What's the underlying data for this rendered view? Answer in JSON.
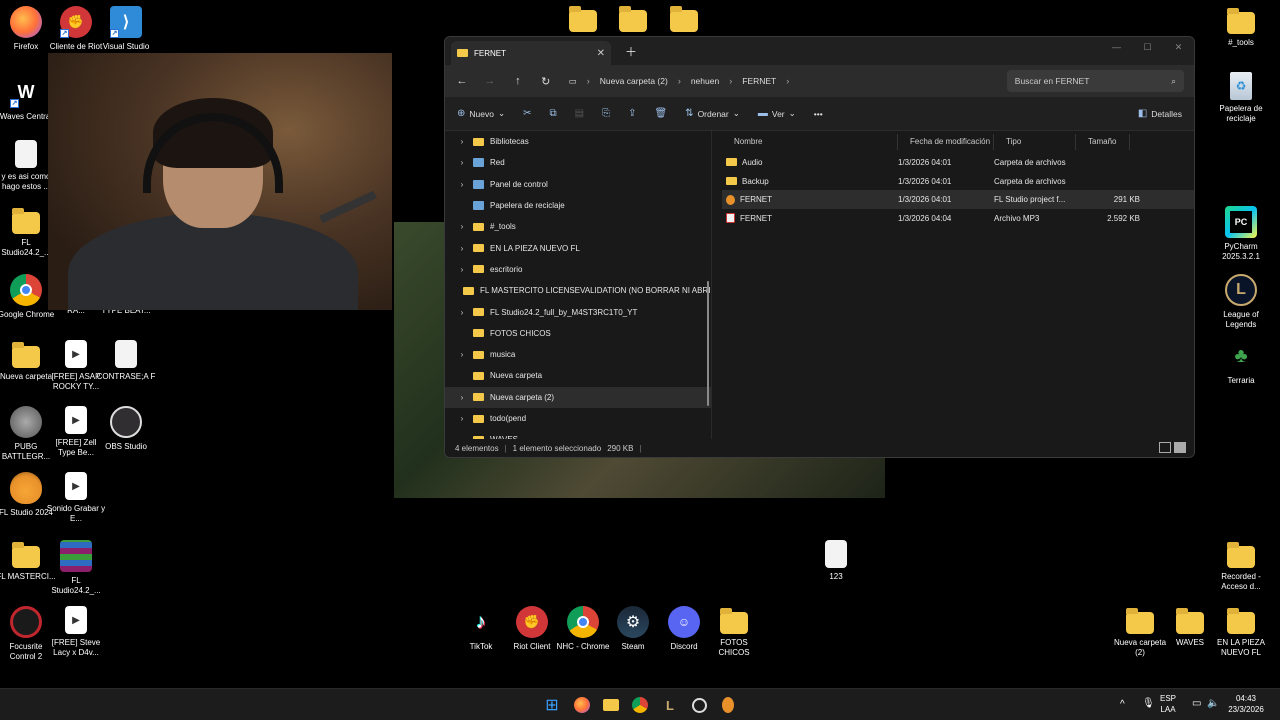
{
  "desktop": {
    "left_icons": [
      {
        "label": "Firefox",
        "icon": "firefox-icon",
        "color": "#ff7139"
      },
      {
        "label": "Cliente de Riot",
        "icon": "riot-icon",
        "color": "#d13639"
      },
      {
        "label": "Visual Studio Code",
        "icon": "vscode-icon",
        "color": "#2f8bd8"
      },
      {
        "label": "Waves Central",
        "icon": "waves-icon",
        "color": "#111111"
      },
      {
        "label": "y es asi como hago estos ...",
        "icon": "document-icon",
        "color": "#f3f3f3"
      },
      {
        "label": "FL Studio24.2_...",
        "icon": "folder-icon",
        "color": "#f4c949"
      },
      {
        "label": "Google Chrome",
        "icon": "chrome-icon",
        "color": "#4285f4"
      },
      {
        "label": "[FREE] ISAIAH RA...",
        "icon": "audio-file-icon",
        "color": "#ffffff"
      },
      {
        "label": "[FREE] CISCO TYPE BEAT...",
        "icon": "audio-file-icon",
        "color": "#ffffff"
      },
      {
        "label": "Nueva carpeta",
        "icon": "folder-icon",
        "color": "#f4c949"
      },
      {
        "label": "[FREE] ASAP ROCKY TY...",
        "icon": "audio-file-icon",
        "color": "#ffffff"
      },
      {
        "label": "CONTRASE;A F",
        "icon": "document-icon",
        "color": "#f3f3f3"
      },
      {
        "label": "PUBG BATTLEGR...",
        "icon": "pubg-icon",
        "color": "#888888"
      },
      {
        "label": "[FREE] Zell Type Be...",
        "icon": "audio-file-icon",
        "color": "#ffffff"
      },
      {
        "label": "OBS Studio",
        "icon": "obs-icon",
        "color": "#333333"
      },
      {
        "label": "FL Studio 2024",
        "icon": "fl-studio-icon",
        "color": "#e8912b"
      },
      {
        "label": "Sonido Grabar y E...",
        "icon": "audio-file-icon",
        "color": "#ffffff"
      },
      {
        "label": "FL MASTERCI...",
        "icon": "folder-icon",
        "color": "#f4c949"
      },
      {
        "label": "FL Studio24.2_...",
        "icon": "winrar-icon",
        "color": "#8b1f6b"
      },
      {
        "label": "Focusrite Control 2",
        "icon": "focusrite-icon",
        "color": "#c0262d"
      },
      {
        "label": "[FREE] Steve Lacy x D4v...",
        "icon": "audio-file-icon",
        "color": "#ffffff"
      }
    ],
    "right_icons": [
      {
        "label": "#_tools",
        "icon": "folder-icon"
      },
      {
        "label": "Papelera de reciclaje",
        "icon": "recycle-bin-icon"
      },
      {
        "label": "PyCharm 2025.3.2.1",
        "icon": "pycharm-icon"
      },
      {
        "label": "League of Legends",
        "icon": "league-icon"
      },
      {
        "label": "Terraria",
        "icon": "terraria-icon"
      },
      {
        "label": "Recorded - Acceso d...",
        "icon": "folder-icon"
      }
    ],
    "center_file": {
      "label": "123",
      "icon": "document-icon"
    },
    "dock_icons": [
      {
        "label": "TikTok",
        "icon": "tiktok-icon",
        "color": "#000000"
      },
      {
        "label": "Riot Client",
        "icon": "riot-icon",
        "color": "#d13639"
      },
      {
        "label": "NHC - Chrome",
        "icon": "chrome-icon",
        "color": "#4285f4"
      },
      {
        "label": "Steam",
        "icon": "steam-icon",
        "color": "#1b2838"
      },
      {
        "label": "Discord",
        "icon": "discord-icon",
        "color": "#5865f2"
      },
      {
        "label": "FOTOS CHICOS",
        "icon": "folder-icon",
        "color": "#f4c949"
      }
    ],
    "bottom_right_icons": [
      {
        "label": "Nueva carpeta (2)",
        "icon": "folder-icon"
      },
      {
        "label": "WAVES",
        "icon": "folder-icon"
      },
      {
        "label": "EN LA PIEZA NUEVO FL",
        "icon": "folder-icon"
      }
    ]
  },
  "explorer": {
    "tab_title": "FERNET",
    "breadcrumb": [
      "Nueva carpeta (2)",
      "nehuen",
      "FERNET"
    ],
    "search_placeholder": "Buscar en FERNET",
    "toolbar": {
      "new_label": "Nuevo",
      "sort_label": "Ordenar",
      "view_label": "Ver",
      "details_label": "Detalles"
    },
    "nav_items": [
      {
        "label": "Bibliotecas",
        "expandable": true,
        "type": "folder"
      },
      {
        "label": "Red",
        "expandable": true,
        "type": "system"
      },
      {
        "label": "Panel de control",
        "expandable": true,
        "type": "system"
      },
      {
        "label": "Papelera de reciclaje",
        "expandable": false,
        "type": "system"
      },
      {
        "label": "#_tools",
        "expandable": true,
        "type": "folder"
      },
      {
        "label": "EN LA PIEZA NUEVO FL",
        "expandable": true,
        "type": "folder"
      },
      {
        "label": "escritorio",
        "expandable": true,
        "type": "folder"
      },
      {
        "label": "FL MASTERCITO LICENSEVALIDATION (NO BORRAR NI ABRIR)",
        "expandable": false,
        "type": "folder"
      },
      {
        "label": "FL Studio24.2_full_by_M4ST3RC1T0_YT",
        "expandable": true,
        "type": "folder"
      },
      {
        "label": "FOTOS CHICOS",
        "expandable": false,
        "type": "folder"
      },
      {
        "label": "musica",
        "expandable": true,
        "type": "folder"
      },
      {
        "label": "Nueva carpeta",
        "expandable": false,
        "type": "folder"
      },
      {
        "label": "Nueva carpeta (2)",
        "expandable": true,
        "type": "folder",
        "selected": true
      },
      {
        "label": "todo(pend",
        "expandable": true,
        "type": "folder"
      },
      {
        "label": "WAVES",
        "expandable": false,
        "type": "folder"
      }
    ],
    "columns": [
      "Nombre",
      "Fecha de modificación",
      "Tipo",
      "Tamaño"
    ],
    "files": [
      {
        "name": "Audio",
        "date": "1/3/2026 04:01",
        "type": "Carpeta de archivos",
        "size": "",
        "icon": "folder-icon"
      },
      {
        "name": "Backup",
        "date": "1/3/2026 04:01",
        "type": "Carpeta de archivos",
        "size": "",
        "icon": "folder-icon"
      },
      {
        "name": "FERNET",
        "date": "1/3/2026 04:01",
        "type": "FL Studio project f...",
        "size": "291 KB",
        "icon": "flp-file-icon",
        "selected": true
      },
      {
        "name": "FERNET",
        "date": "1/3/2026 04:04",
        "type": "Archivo MP3",
        "size": "2.592 KB",
        "icon": "mp3-file-icon"
      }
    ],
    "status": {
      "count": "4 elementos",
      "selection": "1 elemento seleccionado",
      "size": "290 KB"
    }
  },
  "taskbar": {
    "apps": [
      "start-icon",
      "firefox-icon",
      "file-explorer-icon",
      "chrome-icon",
      "league-icon",
      "obs-icon",
      "fl-studio-icon"
    ],
    "lang_top": "ESP",
    "lang_bottom": "LAA",
    "time": "04:43",
    "date": "23/3/2026"
  }
}
